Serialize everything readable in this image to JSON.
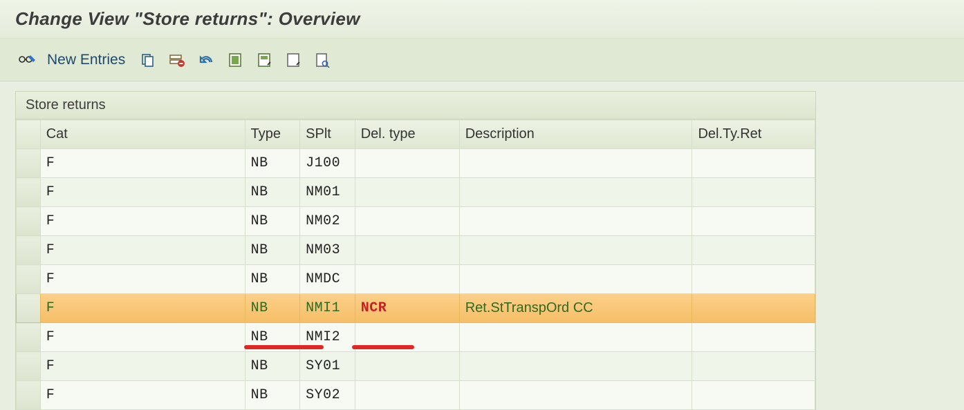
{
  "title": "Change View \"Store returns\": Overview",
  "toolbar": {
    "new_entries_label": "New Entries"
  },
  "panel": {
    "title": "Store returns"
  },
  "columns": {
    "cat": "Cat",
    "type": "Type",
    "splt": "SPlt",
    "del": "Del. type",
    "desc": "Description",
    "ret": "Del.Ty.Ret"
  },
  "rows": [
    {
      "cat": "F",
      "type": "NB",
      "splt": "J100",
      "del": "",
      "desc": "",
      "ret": "",
      "sel": false
    },
    {
      "cat": "F",
      "type": "NB",
      "splt": "NM01",
      "del": "",
      "desc": "",
      "ret": "",
      "sel": false
    },
    {
      "cat": "F",
      "type": "NB",
      "splt": "NM02",
      "del": "",
      "desc": "",
      "ret": "",
      "sel": false
    },
    {
      "cat": "F",
      "type": "NB",
      "splt": "NM03",
      "del": "",
      "desc": "",
      "ret": "",
      "sel": false
    },
    {
      "cat": "F",
      "type": "NB",
      "splt": "NMDC",
      "del": "",
      "desc": "",
      "ret": "",
      "sel": false
    },
    {
      "cat": "F",
      "type": "NB",
      "splt": "NMI1",
      "del": "NCR",
      "desc": "Ret.StTranspOrd CC",
      "ret": "",
      "sel": true
    },
    {
      "cat": "F",
      "type": "NB",
      "splt": "NMI2",
      "del": "",
      "desc": "",
      "ret": "",
      "sel": false
    },
    {
      "cat": "F",
      "type": "NB",
      "splt": "SY01",
      "del": "",
      "desc": "",
      "ret": "",
      "sel": false
    },
    {
      "cat": "F",
      "type": "NB",
      "splt": "SY02",
      "del": "",
      "desc": "",
      "ret": "",
      "sel": false
    }
  ]
}
